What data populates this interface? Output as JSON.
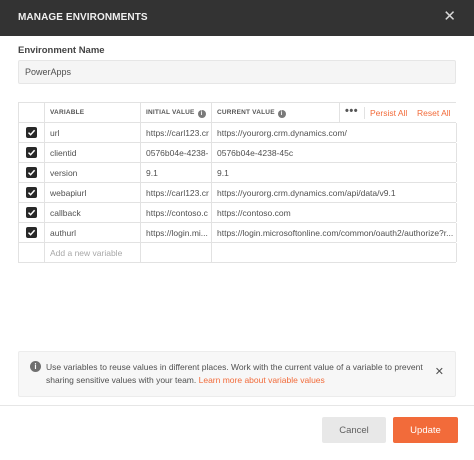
{
  "dialog": {
    "title": "MANAGE ENVIRONMENTS",
    "close_glyph": "✕"
  },
  "env": {
    "label": "Environment Name",
    "value": "PowerApps"
  },
  "table": {
    "headers": {
      "variable": "VARIABLE",
      "initial": "INITIAL VALUE",
      "current": "CURRENT VALUE",
      "more": "•••",
      "persist": "Persist All",
      "reset": "Reset All"
    },
    "rows": [
      {
        "variable": "url",
        "initial": "https://carl123.cr",
        "current": "https://yourorg.crm.dynamics.com/"
      },
      {
        "variable": "clientid",
        "initial": "0576b04e-4238-",
        "current": "0576b04e-4238-45c"
      },
      {
        "variable": "version",
        "initial": "9.1",
        "current": "9.1"
      },
      {
        "variable": "webapiurl",
        "initial": "https://carl123.cr",
        "current": "https://yourorg.crm.dynamics.com/api/data/v9.1"
      },
      {
        "variable": "callback",
        "initial": "https://contoso.c",
        "current": "https://contoso.com"
      },
      {
        "variable": "authurl",
        "initial": "https://login.mi...",
        "current": "https://login.microsoftonline.com/common/oauth2/authorize?r..."
      }
    ],
    "add_placeholder": "Add a new variable"
  },
  "notice": {
    "text": "Use variables to reuse values in different places. Work with the current value of a variable to prevent sharing sensitive values with your team. ",
    "link": "Learn more about variable values"
  },
  "buttons": {
    "cancel": "Cancel",
    "update": "Update"
  },
  "colors": {
    "accent": "#f26b3a",
    "titlebar": "#333333"
  }
}
